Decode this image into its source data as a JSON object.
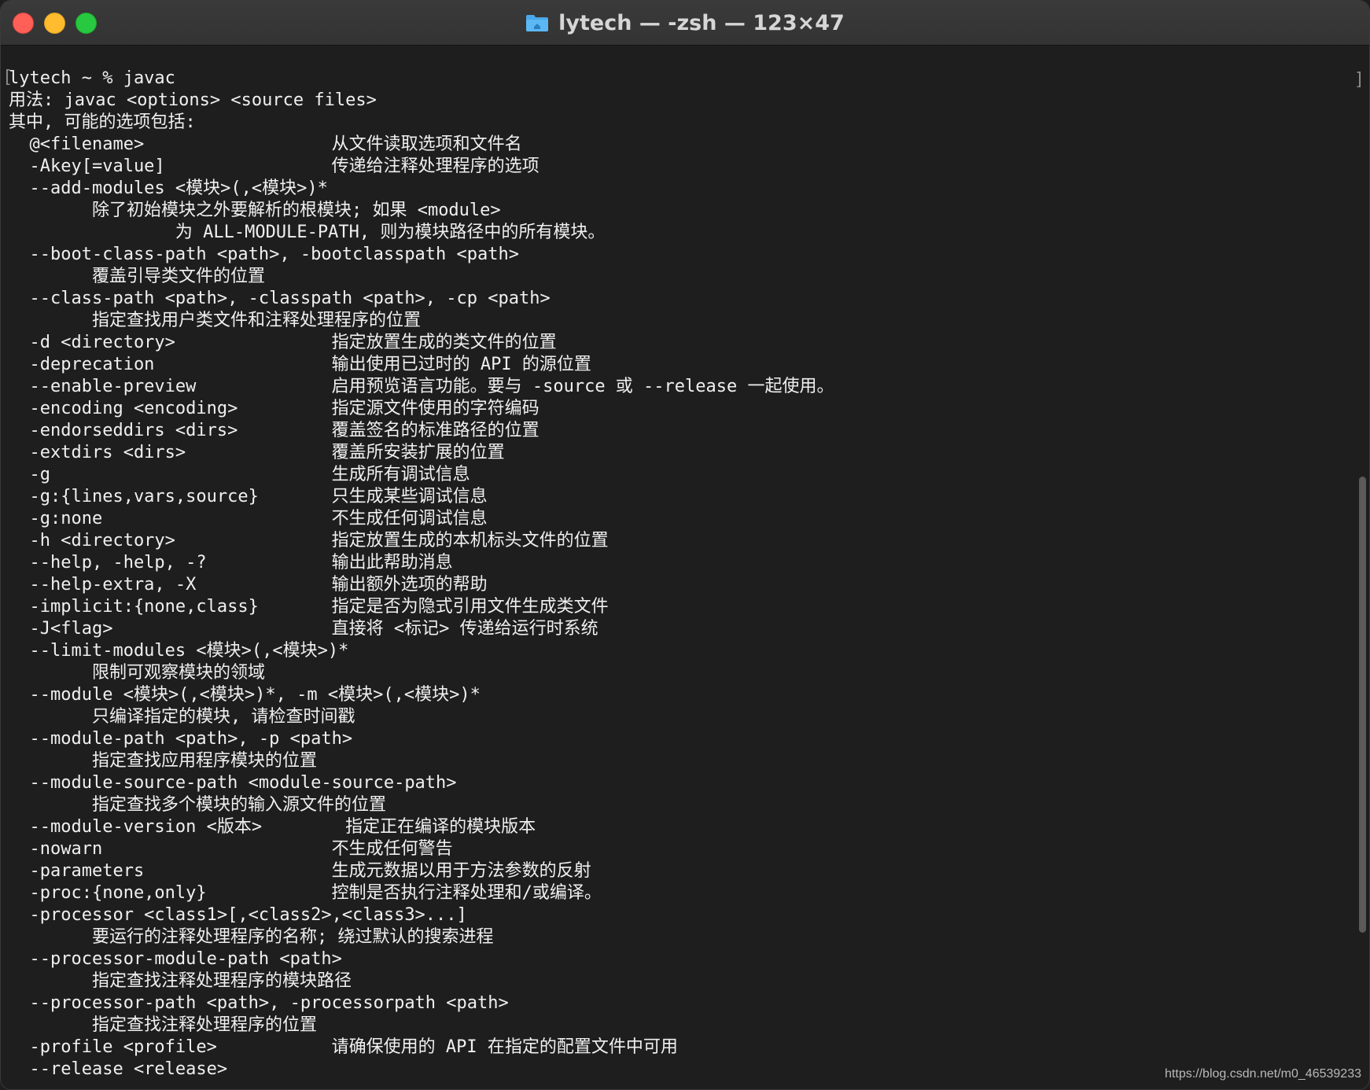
{
  "window": {
    "title": "lytech — -zsh — 123×47",
    "title_icon": "folder-home-icon",
    "controls": [
      "close",
      "minimize",
      "maximize"
    ]
  },
  "terminal": {
    "lines": [
      "lytech ~ % javac",
      "用法: javac <options> <source files>",
      "其中, 可能的选项包括:",
      "  @<filename>                  从文件读取选项和文件名",
      "  -Akey[=value]                传递给注释处理程序的选项",
      "  --add-modules <模块>(,<模块>)*",
      "        除了初始模块之外要解析的根模块; 如果 <module>",
      "                为 ALL-MODULE-PATH, 则为模块路径中的所有模块。",
      "  --boot-class-path <path>, -bootclasspath <path>",
      "        覆盖引导类文件的位置",
      "  --class-path <path>, -classpath <path>, -cp <path>",
      "        指定查找用户类文件和注释处理程序的位置",
      "  -d <directory>               指定放置生成的类文件的位置",
      "  -deprecation                 输出使用已过时的 API 的源位置",
      "  --enable-preview             启用预览语言功能。要与 -source 或 --release 一起使用。",
      "  -encoding <encoding>         指定源文件使用的字符编码",
      "  -endorseddirs <dirs>         覆盖签名的标准路径的位置",
      "  -extdirs <dirs>              覆盖所安装扩展的位置",
      "  -g                           生成所有调试信息",
      "  -g:{lines,vars,source}       只生成某些调试信息",
      "  -g:none                      不生成任何调试信息",
      "  -h <directory>               指定放置生成的本机标头文件的位置",
      "  --help, -help, -?            输出此帮助消息",
      "  --help-extra, -X             输出额外选项的帮助",
      "  -implicit:{none,class}       指定是否为隐式引用文件生成类文件",
      "  -J<flag>                     直接将 <标记> 传递给运行时系统",
      "  --limit-modules <模块>(,<模块>)*",
      "        限制可观察模块的领域",
      "  --module <模块>(,<模块>)*, -m <模块>(,<模块>)*",
      "        只编译指定的模块, 请检查时间戳",
      "  --module-path <path>, -p <path>",
      "        指定查找应用程序模块的位置",
      "  --module-source-path <module-source-path>",
      "        指定查找多个模块的输入源文件的位置",
      "  --module-version <版本>        指定正在编译的模块版本",
      "  -nowarn                      不生成任何警告",
      "  -parameters                  生成元数据以用于方法参数的反射",
      "  -proc:{none,only}            控制是否执行注释处理和/或编译。",
      "  -processor <class1>[,<class2>,<class3>...]",
      "        要运行的注释处理程序的名称; 绕过默认的搜索进程",
      "  --processor-module-path <path>",
      "        指定查找注释处理程序的模块路径",
      "  --processor-path <path>, -processorpath <path>",
      "        指定查找注释处理程序的位置",
      "  -profile <profile>           请确保使用的 API 在指定的配置文件中可用",
      "  --release <release>"
    ]
  },
  "watermark": "https://blog.csdn.net/m0_46539233",
  "colors": {
    "background": "#1e1e1e",
    "text": "#f0f0f0",
    "titlebar": "#363636",
    "close": "#fe5f57",
    "minimize": "#febc2e",
    "maximize": "#28c840"
  }
}
